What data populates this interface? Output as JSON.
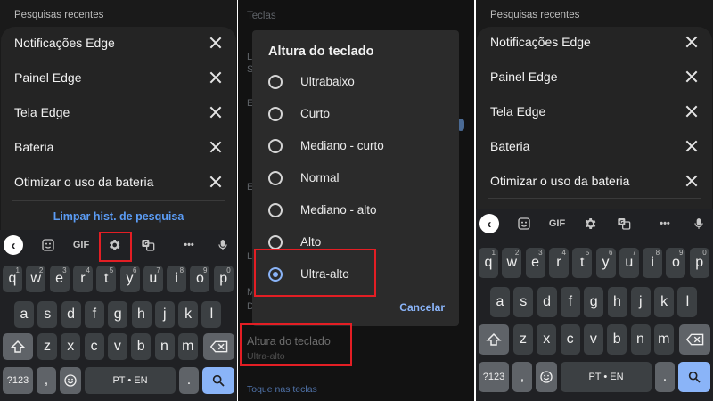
{
  "left_panel": {
    "header": "Pesquisas recentes",
    "items": [
      "Notificações Edge",
      "Painel Edge",
      "Tela Edge",
      "Bateria",
      "Otimizar o uso da bateria"
    ],
    "clear_link": "Limpar hist. de pesquisa"
  },
  "right_panel": {
    "header": "Pesquisas recentes",
    "items": [
      "Notificações Edge",
      "Painel Edge",
      "Tela Edge",
      "Bateria",
      "Otimizar o uso da bateria"
    ]
  },
  "keyboard": {
    "toolbar": {
      "gif": "GIF",
      "more": "•••"
    },
    "row1": [
      {
        "k": "q",
        "n": "1"
      },
      {
        "k": "w",
        "n": "2"
      },
      {
        "k": "e",
        "n": "3"
      },
      {
        "k": "r",
        "n": "4"
      },
      {
        "k": "t",
        "n": "5"
      },
      {
        "k": "y",
        "n": "6"
      },
      {
        "k": "u",
        "n": "7"
      },
      {
        "k": "i",
        "n": "8"
      },
      {
        "k": "o",
        "n": "9"
      },
      {
        "k": "p",
        "n": "0"
      }
    ],
    "row2": [
      "a",
      "s",
      "d",
      "f",
      "g",
      "h",
      "j",
      "k",
      "l"
    ],
    "row3": [
      "z",
      "x",
      "c",
      "v",
      "b",
      "n",
      "m"
    ],
    "symbols": "?123",
    "comma": ",",
    "space": "PT • EN",
    "period": "."
  },
  "middle_panel": {
    "section_top": "Teclas",
    "dialog": {
      "title": "Altura do teclado",
      "options": [
        "Ultrabaixo",
        "Curto",
        "Mediano - curto",
        "Normal",
        "Mediano - alto",
        "Alto",
        "Ultra-alto"
      ],
      "selected_index": 6,
      "cancel": "Cancelar"
    },
    "setting_title": "Altura do teclado",
    "setting_value": "Ultra-alto",
    "section_bottom": "Toque nas teclas",
    "bg_fragments": [
      "L",
      "S",
      "E",
      "E",
      "L",
      "M",
      "D"
    ]
  },
  "colors": {
    "highlight": "#e31e24",
    "accent": "#8ab4f8",
    "link": "#5b9cf5"
  }
}
